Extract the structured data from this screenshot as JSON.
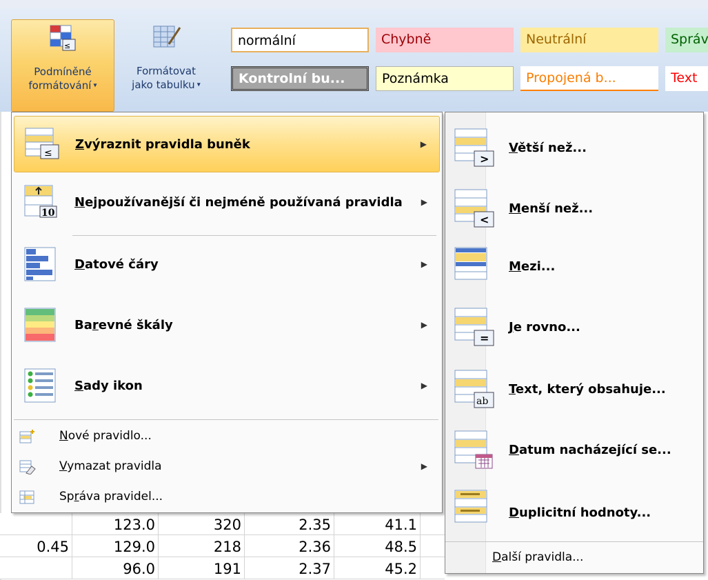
{
  "ribbon": {
    "conditional_formatting": {
      "line1": "Podmíněné",
      "line2": "formátování"
    },
    "format_as_table": {
      "line1": "Formátovat",
      "line2": "jako tabulku"
    },
    "cell_styles": [
      {
        "label": "normální"
      },
      {
        "label": "Chybně"
      },
      {
        "label": "Neutrální"
      },
      {
        "label": "Správ"
      },
      {
        "label": "Kontrolní bu..."
      },
      {
        "label": "Poznámka"
      },
      {
        "label": "Propojená b..."
      },
      {
        "label": "Text"
      }
    ]
  },
  "sheet": {
    "rows": [
      [
        "",
        "123.0",
        "320",
        "2.35",
        "41.1"
      ],
      [
        "0.45",
        "129.0",
        "218",
        "2.36",
        "48.5"
      ],
      [
        "",
        "96.0",
        "191",
        "2.37",
        "45.2"
      ]
    ]
  },
  "menu": {
    "highlight_rules": {
      "pre": "",
      "u": "Z",
      "post": "výraznit pravidla buněk"
    },
    "top_bottom": {
      "pre": "",
      "u": "N",
      "post": "ejpoužívanější či nejméně používaná pravidla"
    },
    "data_bars": {
      "pre": "",
      "u": "D",
      "post": "atové čáry"
    },
    "color_scales": {
      "pre": "Ba",
      "u": "r",
      "post": "evné škály"
    },
    "icon_sets": {
      "pre": "",
      "u": "S",
      "post": "ady ikon"
    },
    "new_rule": {
      "pre": "",
      "u": "N",
      "post": "ové pravidlo..."
    },
    "clear_rules": {
      "pre": "",
      "u": "V",
      "post": "ymazat pravidla"
    },
    "manage_rules": {
      "pre": "Sp",
      "u": "r",
      "post": "áva pravidel..."
    }
  },
  "submenu": {
    "greater_than": {
      "pre": "",
      "u": "V",
      "post": "ětší než..."
    },
    "less_than": {
      "pre": "",
      "u": "M",
      "post": "enší než..."
    },
    "between": {
      "pre": "",
      "u": "M",
      "post": "ezi..."
    },
    "equal_to": {
      "pre": "",
      "u": "J",
      "post": "e rovno..."
    },
    "text_contains": {
      "pre": "",
      "u": "T",
      "post": "ext, který obsahuje..."
    },
    "date_occurring": {
      "pre": "",
      "u": "D",
      "post": "atum nacházející se..."
    },
    "duplicate_values": {
      "pre": "",
      "u": "D",
      "post": "uplicitní hodnoty..."
    },
    "more_rules": {
      "pre": "",
      "u": "D",
      "post": "alší pravidla..."
    }
  },
  "colors": {
    "menu_highlight": "#ffd05a",
    "ribbon_bg": "#d6e3f3",
    "bad_bg": "#ffc7ce",
    "neutral_bg": "#ffeb9c",
    "good_bg": "#c6efce",
    "note_bg": "#ffffcc"
  }
}
